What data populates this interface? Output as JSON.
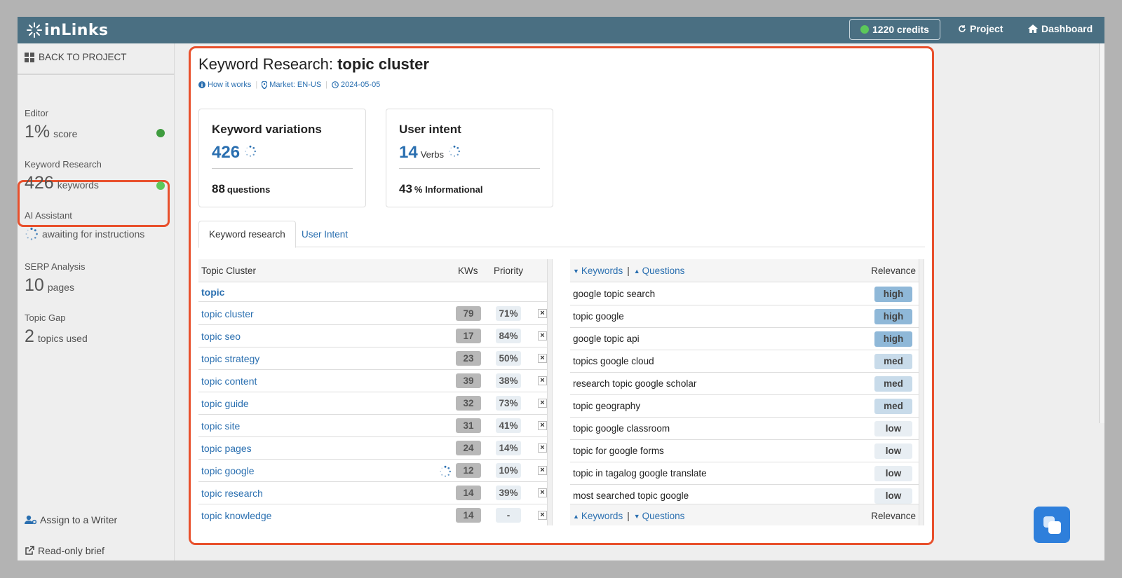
{
  "header": {
    "logo_text": "inLinks",
    "credits": "1220 credits",
    "project": "Project",
    "dashboard": "Dashboard"
  },
  "sidebar": {
    "back": "BACK TO PROJECT",
    "items": [
      {
        "label": "Editor",
        "value": "1%",
        "unit": "score",
        "status_color": "#3f9c3f"
      },
      {
        "label": "Keyword Research",
        "value": "426",
        "unit": "keywords",
        "status_color": "#5cc85a"
      },
      {
        "label": "AI Assistant",
        "unit": "awaiting for instructions"
      },
      {
        "label": "SERP Analysis",
        "value": "10",
        "unit": "pages"
      },
      {
        "label": "Topic Gap",
        "value": "2",
        "unit": "topics used"
      }
    ],
    "assign": "Assign to a Writer",
    "readonly": "Read-only brief"
  },
  "main": {
    "title_prefix": "Keyword Research:",
    "title_topic": "topic cluster",
    "meta": {
      "how": "How it works",
      "market": "Market: EN-US",
      "date": "2024-05-05"
    },
    "cards": [
      {
        "title": "Keyword variations",
        "number": "426",
        "number_unit": "",
        "foot_num": "88",
        "foot_text": "questions"
      },
      {
        "title": "User intent",
        "number": "14",
        "number_unit": "Verbs",
        "foot_num": "43",
        "foot_text": "% Informational"
      }
    ],
    "tabs": [
      "Keyword research",
      "User Intent"
    ],
    "left_table": {
      "headers": {
        "cluster": "Topic Cluster",
        "kws": "KWs",
        "priority": "Priority"
      },
      "group": "topic",
      "rows": [
        {
          "kw": "topic cluster",
          "kws": "79",
          "priority": "71%"
        },
        {
          "kw": "topic seo",
          "kws": "17",
          "priority": "84%"
        },
        {
          "kw": "topic strategy",
          "kws": "23",
          "priority": "50%"
        },
        {
          "kw": "topic content",
          "kws": "39",
          "priority": "38%"
        },
        {
          "kw": "topic guide",
          "kws": "32",
          "priority": "73%"
        },
        {
          "kw": "topic site",
          "kws": "31",
          "priority": "41%"
        },
        {
          "kw": "topic pages",
          "kws": "24",
          "priority": "14%"
        },
        {
          "kw": "topic google",
          "kws": "12",
          "priority": "10%"
        },
        {
          "kw": "topic research",
          "kws": "14",
          "priority": "39%"
        },
        {
          "kw": "topic knowledge",
          "kws": "14",
          "priority": "-"
        }
      ],
      "remove_symbol": "×"
    },
    "right_table": {
      "headers": {
        "keywords": "Keywords",
        "sep": "|",
        "questions": "Questions",
        "relevance": "Relevance"
      },
      "rows": [
        {
          "kw": "google topic search",
          "rel": "high"
        },
        {
          "kw": "topic google",
          "rel": "high"
        },
        {
          "kw": "google topic api",
          "rel": "high"
        },
        {
          "kw": "topics google cloud",
          "rel": "med"
        },
        {
          "kw": "research topic google scholar",
          "rel": "med"
        },
        {
          "kw": "topic geography",
          "rel": "med"
        },
        {
          "kw": "topic google classroom",
          "rel": "low"
        },
        {
          "kw": "topic for google forms",
          "rel": "low"
        },
        {
          "kw": "topic in tagalog google translate",
          "rel": "low"
        },
        {
          "kw": "most searched topic google",
          "rel": "low"
        }
      ]
    }
  },
  "colors": {
    "accent": "#2a6fb0",
    "topbar": "#4a6f82",
    "highlight": "#e8502c"
  }
}
